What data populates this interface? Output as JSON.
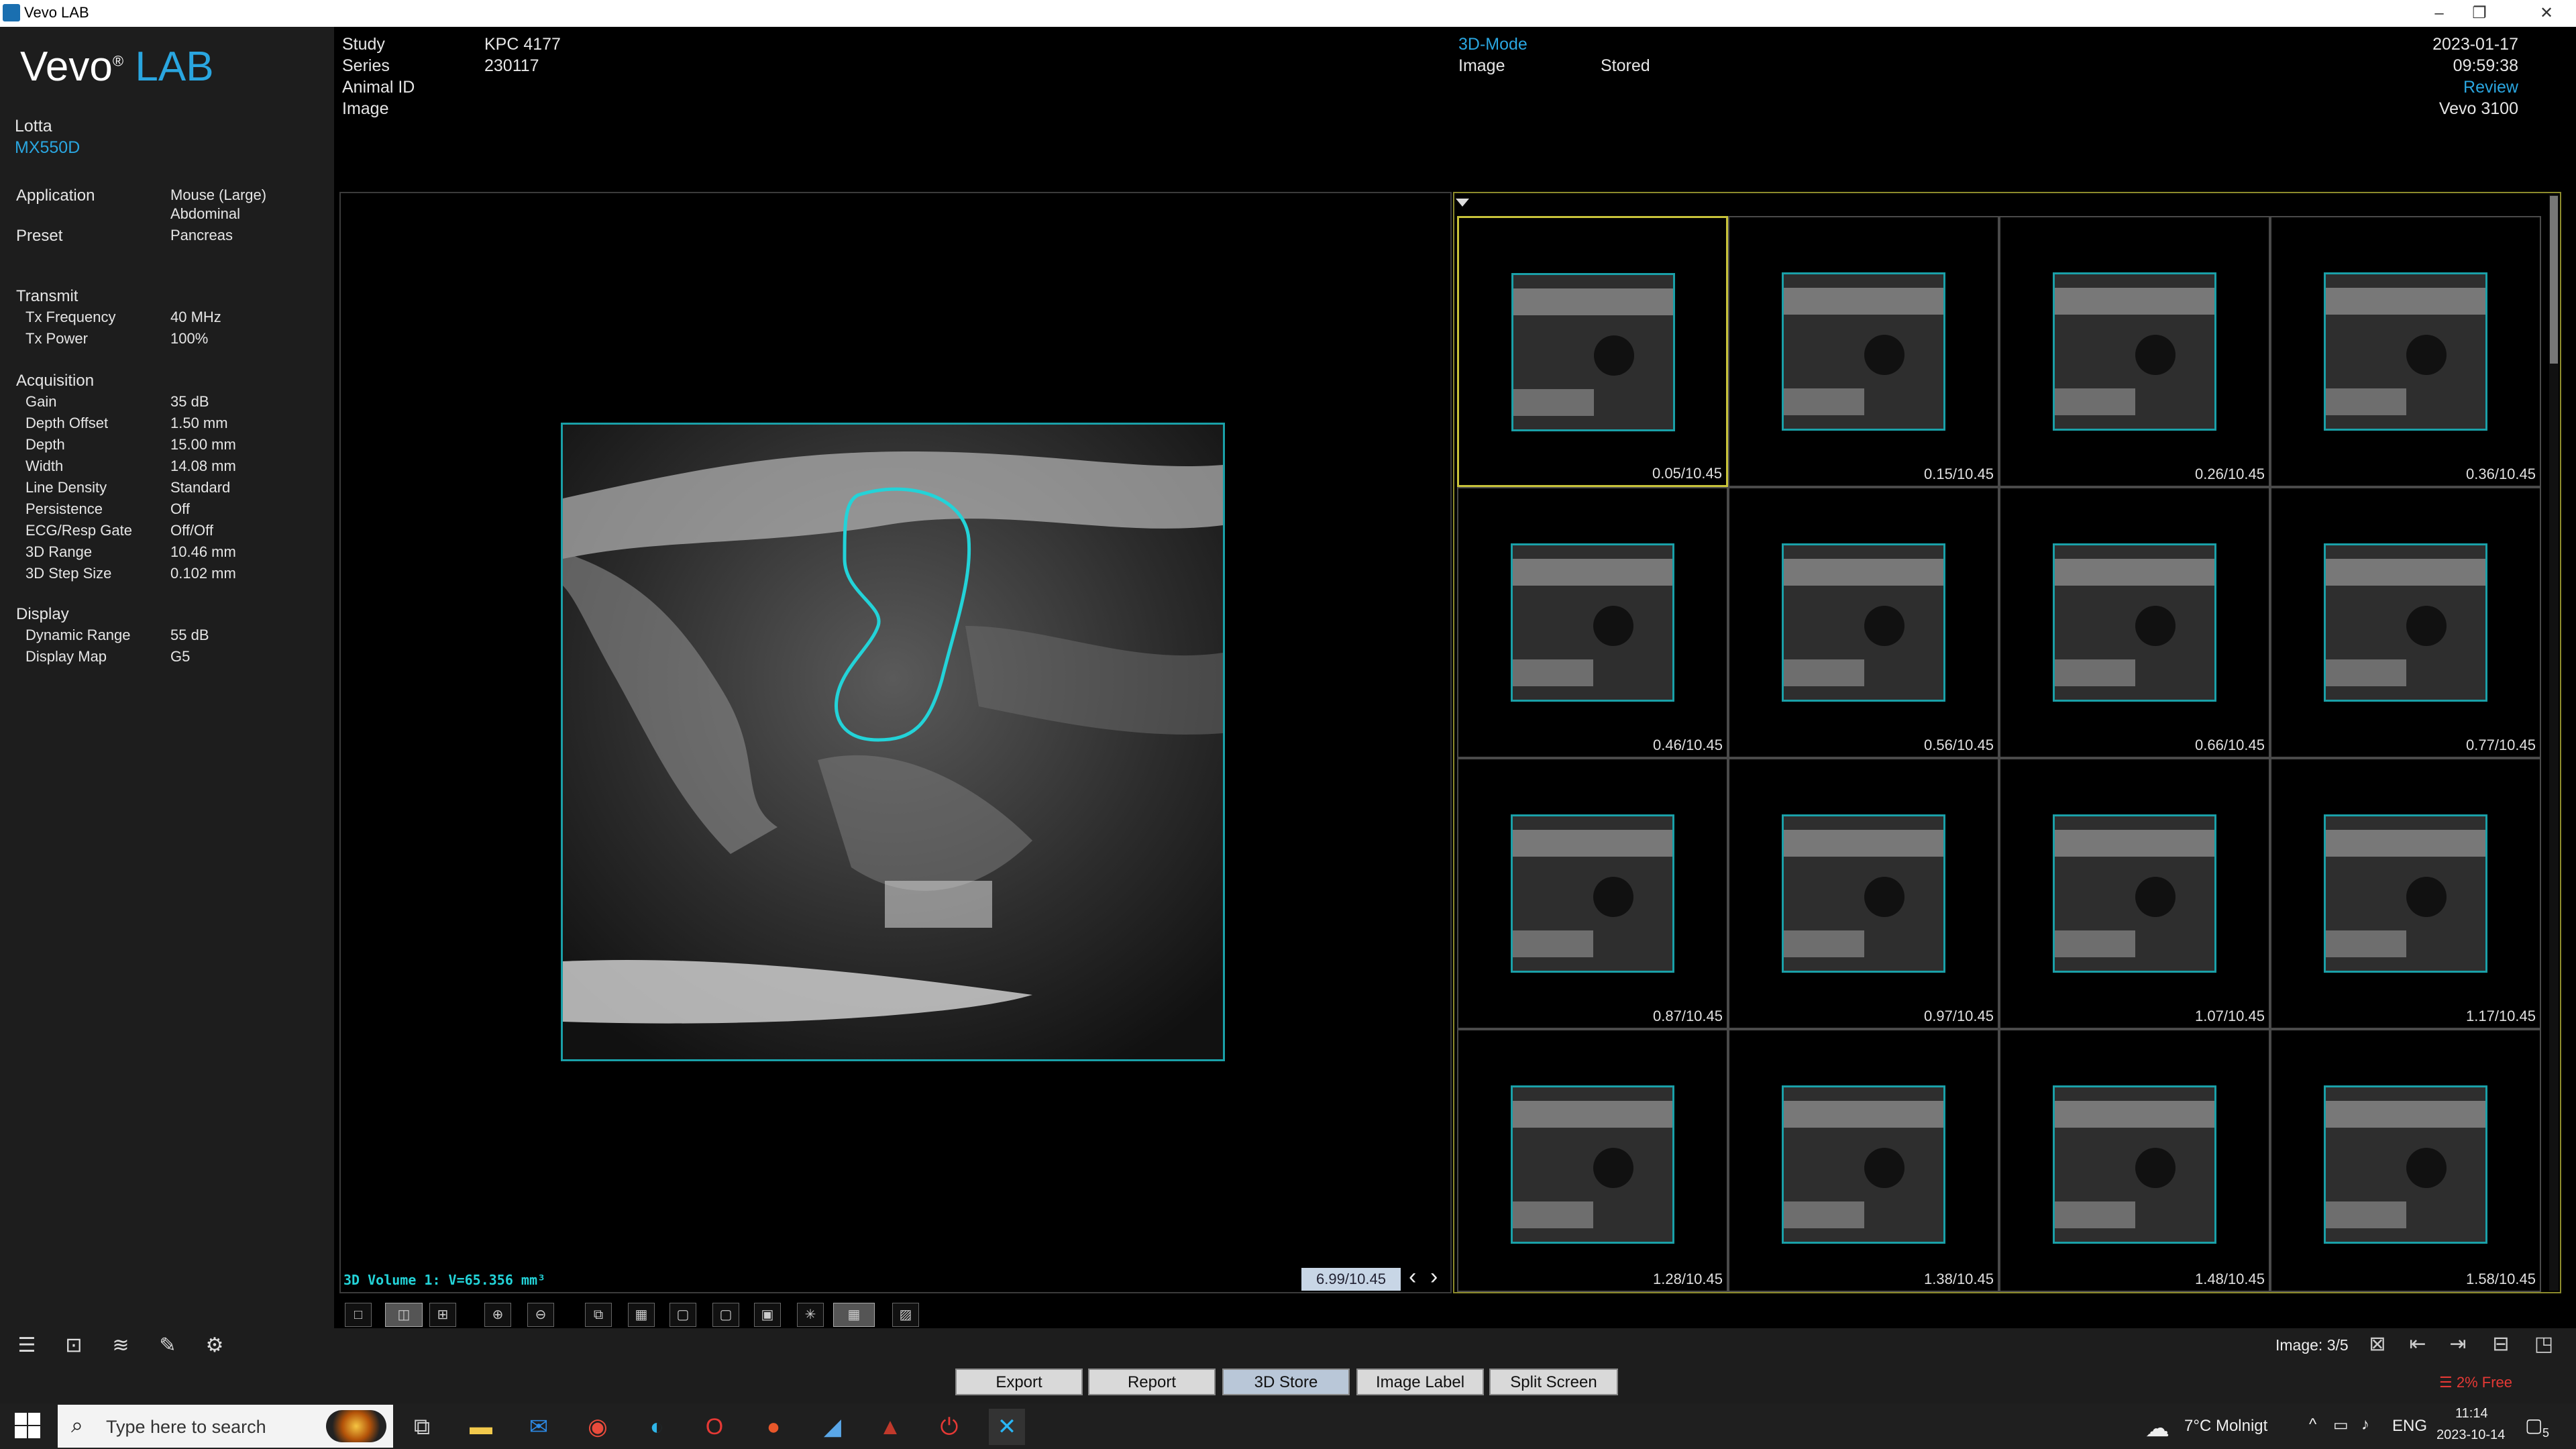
{
  "window": {
    "title": "Vevo LAB",
    "controls": [
      "–",
      "❐",
      "✕"
    ]
  },
  "logo": {
    "vevo": "Vevo",
    "reg": "®",
    "lab": "LAB"
  },
  "user": {
    "name": "Lotta",
    "transducer": "MX550D"
  },
  "params": {
    "application_label": "Application",
    "application_value_1": "Mouse (Large)",
    "application_value_2": "Abdominal",
    "preset_label": "Preset",
    "preset_value": "Pancreas",
    "transmit_header": "Transmit",
    "tx_frequency_label": "Tx Frequency",
    "tx_frequency_value": "40 MHz",
    "tx_power_label": "Tx Power",
    "tx_power_value": "100%",
    "acquisition_header": "Acquisition",
    "rows": [
      {
        "label": "Gain",
        "value": "35 dB"
      },
      {
        "label": "Depth Offset",
        "value": "1.50 mm"
      },
      {
        "label": "Depth",
        "value": "15.00 mm"
      },
      {
        "label": "Width",
        "value": "14.08 mm"
      },
      {
        "label": "Line Density",
        "value": "Standard"
      },
      {
        "label": "Persistence",
        "value": "Off"
      },
      {
        "label": "ECG/Resp Gate",
        "value": "Off/Off"
      },
      {
        "label": "3D Range",
        "value": "10.46 mm"
      },
      {
        "label": "3D Step Size",
        "value": "0.102 mm"
      }
    ],
    "display_header": "Display",
    "display_rows": [
      {
        "label": "Dynamic Range",
        "value": "55 dB"
      },
      {
        "label": "Display Map",
        "value": "G5"
      }
    ]
  },
  "header": {
    "study_label": "Study",
    "study_value": "KPC 4177",
    "series_label": "Series",
    "series_value": "230117",
    "animal_label": "Animal ID",
    "image_label": "Image",
    "mode": "3D-Mode",
    "image_state_label": "Image",
    "image_state_value": "Stored",
    "date": "2023-01-17",
    "time": "09:59:38",
    "review": "Review",
    "system": "Vevo 3100"
  },
  "main": {
    "volume_label": "3D Volume 1: V=65.356 mm³",
    "slice_position": "6.99/10.45",
    "prev_arrow": "‹",
    "next_arrow": "›"
  },
  "thumbnails": [
    "0.05/10.45",
    "0.15/10.45",
    "0.26/10.45",
    "0.36/10.45",
    "0.46/10.45",
    "0.56/10.45",
    "0.66/10.45",
    "0.77/10.45",
    "0.87/10.45",
    "0.97/10.45",
    "1.07/10.45",
    "1.17/10.45",
    "1.28/10.45",
    "1.38/10.45",
    "1.48/10.45",
    "1.58/10.45"
  ],
  "bottom": {
    "image_count": "Image: 3/5",
    "disk_free": "2% Free",
    "buttons": [
      "Export",
      "Report",
      "3D Store",
      "Image Label",
      "Split Screen"
    ]
  },
  "taskbar": {
    "search_placeholder": "Type here to search",
    "weather": "7°C  Molnigt",
    "language": "ENG",
    "time": "11:14",
    "date": "2023-10-14",
    "notifications": "5"
  },
  "colors": {
    "accent": "#2aa6e0",
    "outline": "#1aa0a8",
    "roi": "#23d3d8",
    "selection": "#c8c33a"
  }
}
